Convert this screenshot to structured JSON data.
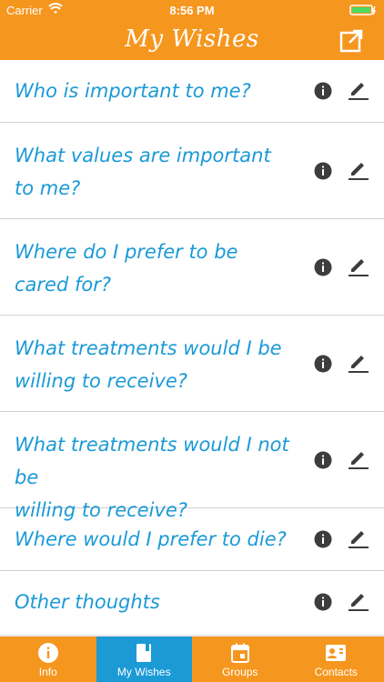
{
  "status_bar": {
    "carrier": "Carrier",
    "time": "8:56 PM"
  },
  "nav": {
    "title": "My Wishes",
    "share_icon": "share-external-icon"
  },
  "rows": [
    {
      "lines": [
        "Who is important to me?"
      ]
    },
    {
      "lines": [
        "What values are important",
        "to me?"
      ]
    },
    {
      "lines": [
        "Where do I prefer to be",
        "cared for?"
      ]
    },
    {
      "lines": [
        "What treatments would I be",
        "willing to receive?"
      ]
    },
    {
      "lines": [
        "What treatments would I not be",
        "willing to receive?"
      ]
    },
    {
      "lines": [
        "Where would I prefer to die?"
      ]
    },
    {
      "lines": [
        "Other thoughts"
      ]
    }
  ],
  "tabs": [
    {
      "label": "Info",
      "icon": "info-icon"
    },
    {
      "label": "My Wishes",
      "icon": "book-icon"
    },
    {
      "label": "Groups",
      "icon": "calendar-icon"
    },
    {
      "label": "Contacts",
      "icon": "contact-card-icon"
    }
  ],
  "colors": {
    "accent": "#f5961e",
    "question_text": "#1b9ad6",
    "active_tab": "#1b9ad6"
  }
}
